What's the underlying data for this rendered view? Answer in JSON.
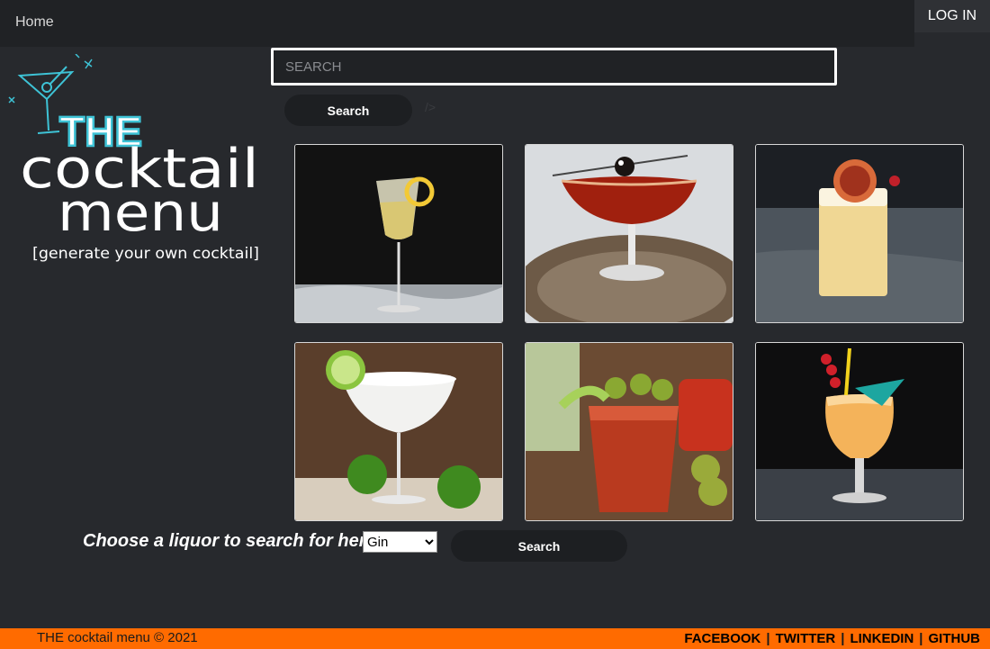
{
  "nav": {
    "home_label": "Home",
    "login_label": "LOG IN"
  },
  "search": {
    "placeholder": "SEARCH",
    "button_label": "Search",
    "code_glyph": "/>"
  },
  "logo": {
    "the": "THE",
    "cocktail": "cocktail",
    "menu": "menu",
    "tagline": "[generate your own cocktail]"
  },
  "cocktails": [
    {
      "icon": "champagne-glass-photo"
    },
    {
      "icon": "coupe-glass-photo"
    },
    {
      "icon": "whiskey-sour-photo"
    },
    {
      "icon": "margarita-photo"
    },
    {
      "icon": "bloody-mary-photo"
    },
    {
      "icon": "tropical-cocktail-photo"
    }
  ],
  "liquor": {
    "label": "Choose a liquor to search for here:",
    "selected": "Gin",
    "button_label": "Search"
  },
  "footer": {
    "copyright": "THE cocktail menu © 2021",
    "links": [
      "FACEBOOK",
      "TWITTER",
      "LINKEDIN",
      "GITHUB"
    ],
    "accent_color": "#ff6b00"
  }
}
